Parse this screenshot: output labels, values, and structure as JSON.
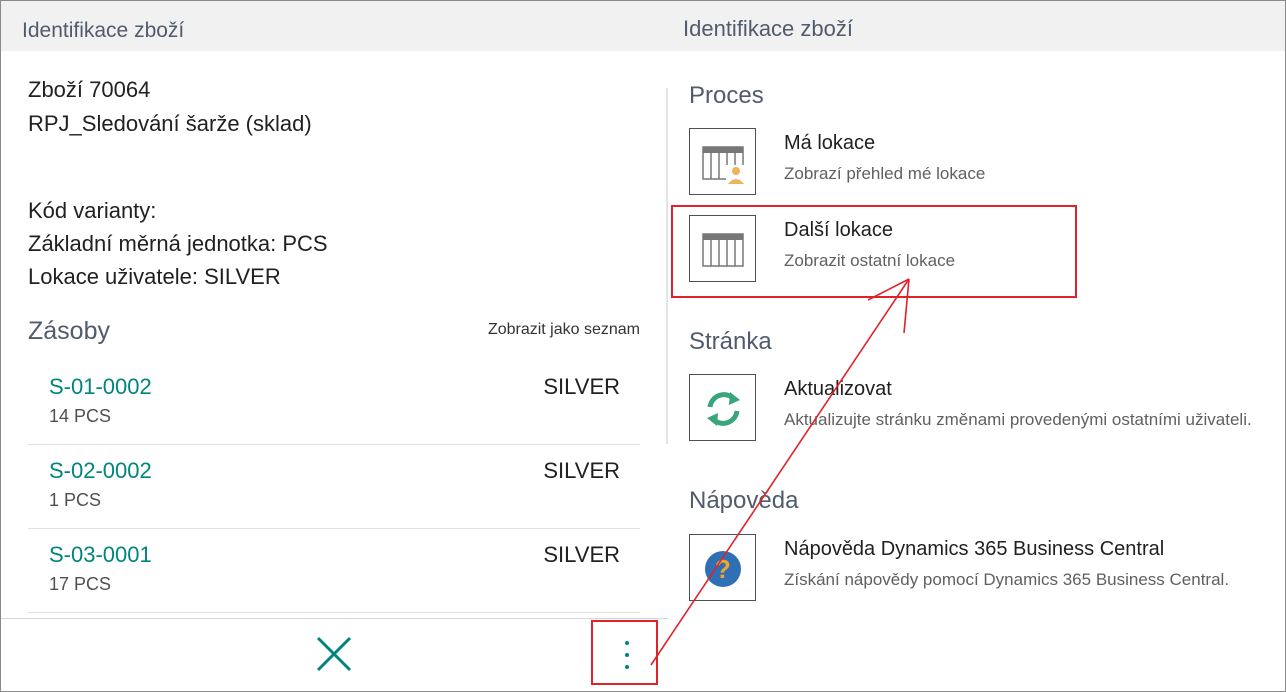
{
  "left_panel": {
    "title": "Identifikace zboží",
    "item_line": "Zboží 70064",
    "item_description": "RPJ_Sledování šarže (sklad)",
    "variant_code": "Kód varianty:",
    "base_uom": "Základní měrná jednotka: PCS",
    "user_location": "Lokace uživatele: SILVER",
    "inventory": {
      "title": "Zásoby",
      "show_as_list": "Zobrazit jako seznam",
      "rows": [
        {
          "code": "S-01-0002",
          "qty": "14 PCS",
          "location": "SILVER"
        },
        {
          "code": "S-02-0002",
          "qty": "1 PCS",
          "location": "SILVER"
        },
        {
          "code": "S-03-0001",
          "qty": "17 PCS",
          "location": "SILVER"
        }
      ]
    }
  },
  "footer": {
    "close_icon": "close-icon",
    "more_icon": "vertical-ellipsis-icon"
  },
  "right_panel": {
    "title": "Identifikace zboží",
    "groups": [
      {
        "title": "Proces",
        "actions": [
          {
            "title": "Má lokace",
            "description": "Zobrazí přehled mé lokace",
            "icon": "table-user-icon"
          },
          {
            "title": "Další lokace",
            "description": "Zobrazit ostatní lokace",
            "icon": "table-icon"
          }
        ]
      },
      {
        "title": "Stránka",
        "actions": [
          {
            "title": "Aktualizovat",
            "description": "Aktualizujte stránku změnami provedenými ostatními uživateli.",
            "icon": "refresh-icon"
          }
        ]
      },
      {
        "title": "Nápověda",
        "actions": [
          {
            "title": "Nápověda Dynamics 365 Business Central",
            "description": "Získání nápovědy pomocí Dynamics 365 Business Central.",
            "icon": "help-icon"
          }
        ]
      }
    ]
  },
  "colors": {
    "accent_teal": "#00857d",
    "highlight_red": "#e0222b",
    "header_bg": "#f1f1f1",
    "heading_slate": "#505c6d"
  }
}
